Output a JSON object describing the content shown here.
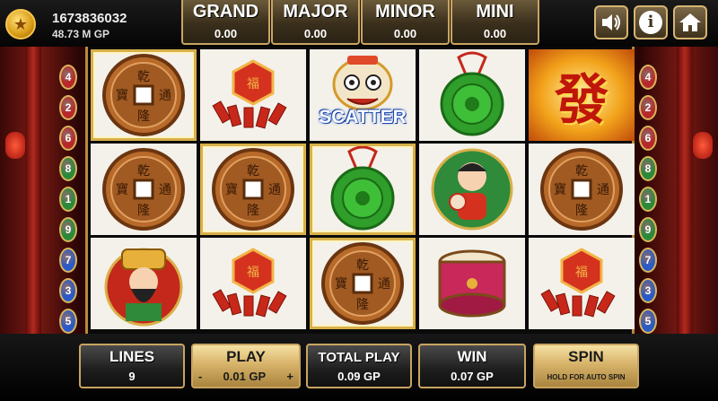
{
  "player": {
    "id": "1673836032",
    "balance": "48.73 M GP"
  },
  "jackpots": [
    {
      "name": "GRAND",
      "value": "0.00"
    },
    {
      "name": "MAJOR",
      "value": "0.00"
    },
    {
      "name": "MINOR",
      "value": "0.00"
    },
    {
      "name": "MINI",
      "value": "0.00"
    }
  ],
  "controls": {
    "sound_icon": "speaker-icon",
    "info_icon": "info-icon",
    "home_icon": "home-icon",
    "info_glyph": "i"
  },
  "left_line_numbers": [
    "4",
    "2",
    "6",
    "8",
    "1",
    "9",
    "7",
    "3",
    "5"
  ],
  "right_line_numbers": [
    "4",
    "2",
    "6",
    "8",
    "1",
    "9",
    "7",
    "3",
    "5"
  ],
  "reels": [
    [
      "coin",
      "coin",
      "god-of-wealth"
    ],
    [
      "firecrackers",
      "coin",
      "firecrackers"
    ],
    [
      "scatter-lion",
      "jade-medallion",
      "coin"
    ],
    [
      "jade-medallion",
      "fortune-boy",
      "drum"
    ],
    [
      "fa-character",
      "coin",
      "firecrackers"
    ]
  ],
  "symbols": {
    "scatter_label": "SCATTER",
    "fa_char": "發",
    "coin_chars": [
      "乾",
      "隆",
      "通",
      "寶"
    ]
  },
  "bottom": {
    "lines_label": "LINES",
    "lines_value": "9",
    "play_label": "PLAY",
    "play_minus": "-",
    "play_value": "0.01 GP",
    "play_plus": "+",
    "total_play_label": "TOTAL PLAY",
    "total_play_value": "0.09 GP",
    "win_label": "WIN",
    "win_value": "0.07 GP",
    "spin_label": "SPIN",
    "spin_sub": "HOLD FOR AUTO SPIN"
  },
  "colors": {
    "frame_gold": "#c9a461",
    "accent_red": "#b22a1c",
    "jade": "#2f9e2a"
  }
}
